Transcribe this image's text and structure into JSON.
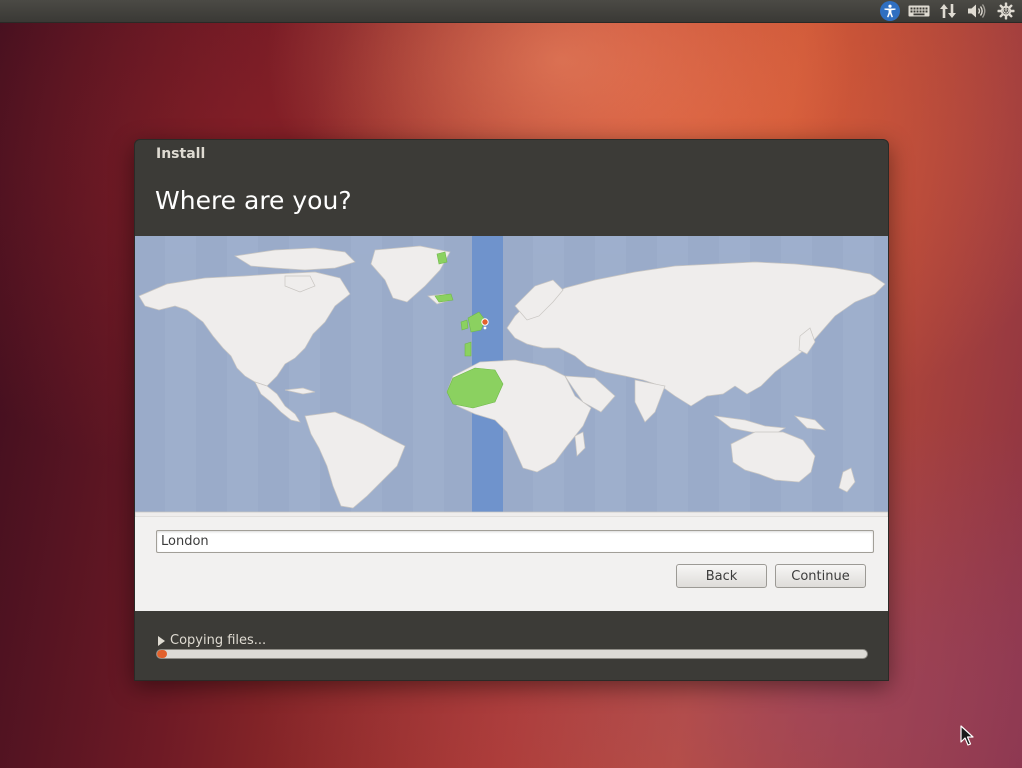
{
  "panel": {
    "indicators": [
      "accessibility-icon",
      "keyboard-icon",
      "network-icon",
      "volume-icon",
      "power-gear-icon"
    ]
  },
  "window": {
    "title": "Install",
    "heading": "Where are you?"
  },
  "location": {
    "value": "London"
  },
  "buttons": {
    "back_label": "Back",
    "continue_label": "Continue"
  },
  "progress": {
    "label": "Copying files...",
    "fraction": 0.01
  },
  "colors": {
    "accent": "#e2612c",
    "map_ocean": "#9aabc9",
    "map_land": "#efedec",
    "timezone_highlight": "#6f93cc",
    "selected_country": "#8bd160"
  }
}
